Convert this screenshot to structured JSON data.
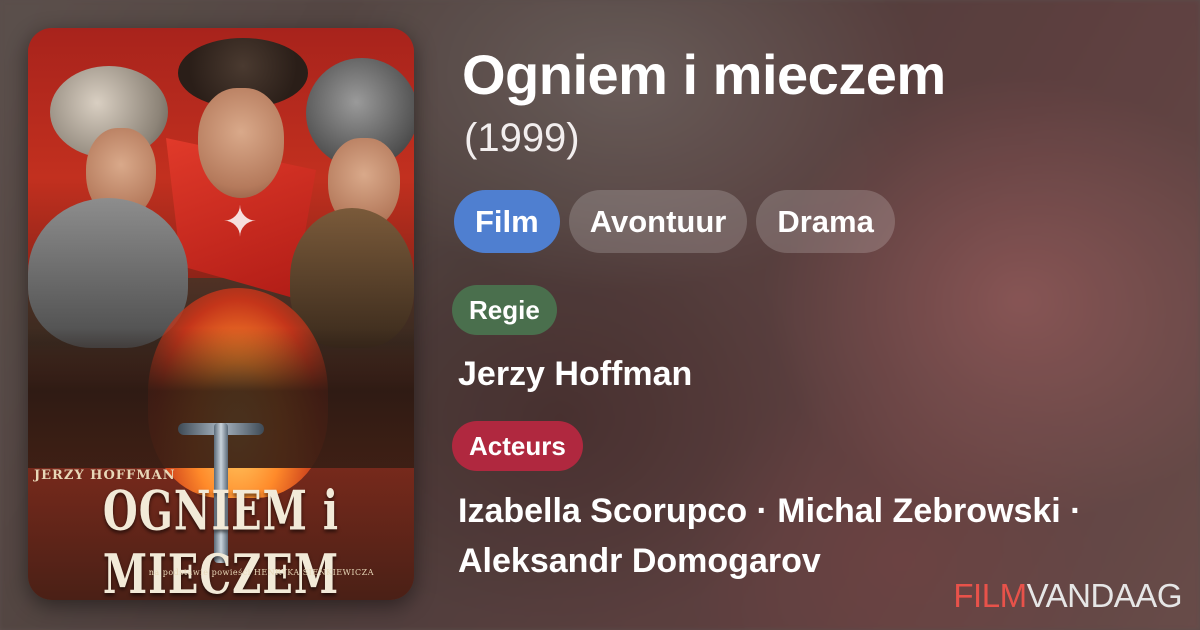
{
  "movie": {
    "title": "Ogniem i mieczem",
    "year": "(1999)"
  },
  "genres": [
    {
      "label": "Film",
      "active": true
    },
    {
      "label": "Avontuur",
      "active": false
    },
    {
      "label": "Drama",
      "active": false
    }
  ],
  "director_section": {
    "badge": "Regie",
    "names": "Jerzy Hoffman"
  },
  "actors_section": {
    "badge": "Acteurs",
    "line1": "Izabella Scorupco · Michal Zebrowski ·",
    "line2": "Aleksandr Domogarov"
  },
  "poster": {
    "director_text": "JERZY HOFFMAN",
    "title_text": "OGNIEM i MIECZEM",
    "subtitle_text": "na podstawie powieści HENRYKA SIENKIEWICZA"
  },
  "logo": {
    "part1": "FILM",
    "part2": "VANDAAG"
  },
  "colors": {
    "genre_active": "#4f7fd0",
    "regie_badge": "#4a6f4d",
    "acteurs_badge": "#b0283f",
    "logo_accent": "#e8524a"
  }
}
